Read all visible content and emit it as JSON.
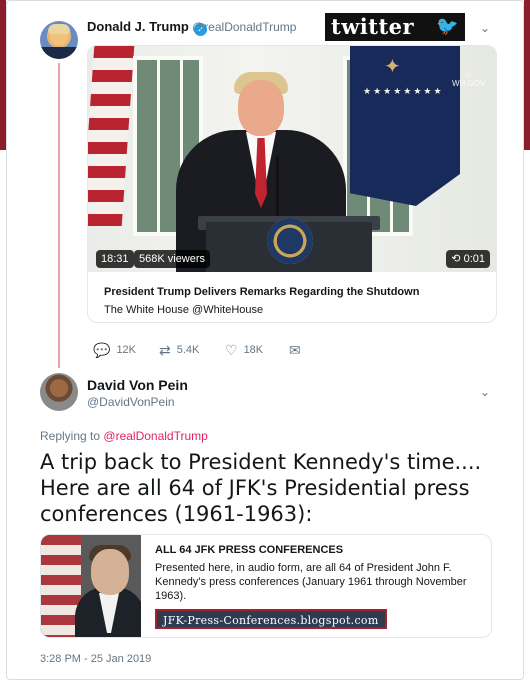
{
  "tweet1": {
    "author_name": "Donald J. Trump",
    "author_handle": "@realDonaldTrump",
    "logo_text": "twitter",
    "video": {
      "duration": "18:31",
      "viewers": "568K viewers",
      "elapsed": "0:01",
      "watermark": "WH.GOV"
    },
    "card_title": "President Trump Delivers Remarks Regarding the Shutdown",
    "card_source": "The White House @WhiteHouse",
    "actions": {
      "replies": "12K",
      "retweets": "5.4K",
      "likes": "18K"
    }
  },
  "tweet2": {
    "author_name": "David Von Pein",
    "author_handle": "@DavidVonPein",
    "replying_prefix": "Replying to",
    "replying_mention": "@realDonaldTrump",
    "text": "A trip back to President Kennedy's time.... Here are all 64 of JFK's Presidential press conferences (1961-1963):",
    "link_card": {
      "title": "ALL 64 JFK PRESS CONFERENCES",
      "description": "Presented here, in audio form, are all 64 of President John F. Kennedy's press conferences (January 1961 through November 1963).",
      "url_label": "JFK-Press-Conferences.blogspot.com"
    },
    "timestamp": "3:28 PM - 25 Jan 2019"
  },
  "colors": {
    "frame_red": "#8b1e2b",
    "twitter_blue": "#1da1f2",
    "mention_red": "#e0245e",
    "muted": "#657786"
  }
}
